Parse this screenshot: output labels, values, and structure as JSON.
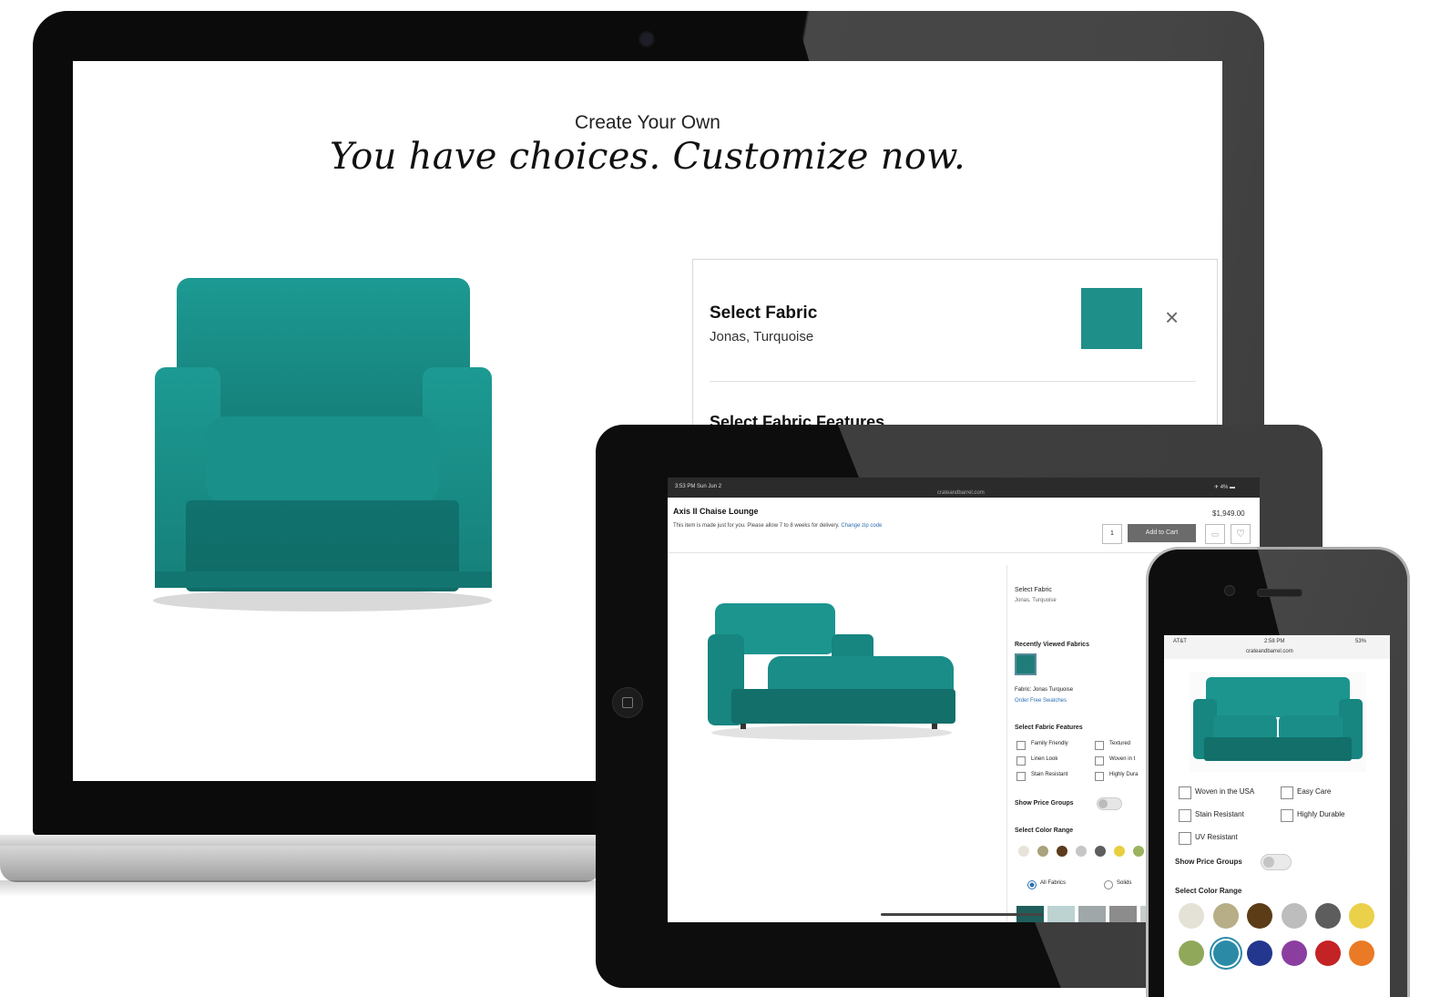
{
  "laptop": {
    "eyebrow": "Create Your Own",
    "headline": "You have choices. Customize now.",
    "panel": {
      "title": "Select Fabric",
      "fabric_name": "Jonas, Turquoise",
      "swatch_color": "#1f8f8a",
      "close_icon": "×",
      "features_heading": "Select Fabric Features"
    }
  },
  "tablet": {
    "status_left": "3:53 PM   Sun Jun 2",
    "status_center": "crateandbarrel.com",
    "status_right": "✈ 4% ▬",
    "product_title": "Axis II Chaise Lounge",
    "note": "This item is made just for you. Please allow 7 to 8 weeks for delivery.",
    "note_link": "Change zip code",
    "price": "$1,949.00",
    "quantity": "1",
    "add_to_cart": "Add to Cart",
    "heart_icon": "♡",
    "side": {
      "select_fabric": "Select Fabric",
      "fabric_value": "Jonas, Turquoise",
      "recently_viewed": "Recently Viewed Fabrics",
      "fabric_line": "Fabric: Jonas Turquoise",
      "order_swatches": "Order Free Swatches",
      "features_heading": "Select Fabric Features",
      "features": [
        "Family Friendly",
        "Textured",
        "Linen Look",
        "Woven in t",
        "Stain Resistant",
        "Highly Dura"
      ],
      "show_price_groups": "Show Price Groups",
      "color_range": "Select Color Range",
      "colors": [
        "#e6e3d8",
        "#a9a27a",
        "#5b3b1a",
        "#c6c6c6",
        "#5e5e5e",
        "#e9cf3e",
        "#9cb35e"
      ],
      "radio_all": "All Fabrics",
      "radio_solids": "Solids"
    },
    "bottom_swatches": [
      "#1f5e5c",
      "#bcd3d2",
      "#9fa7a8",
      "#8c8c8c",
      "#c6cccb"
    ]
  },
  "phone": {
    "status_left": "AT&T",
    "status_time": "2:58 PM",
    "status_right": "53%",
    "url": "crateandbarrel.com",
    "features": [
      "Woven in the USA",
      "Easy Care",
      "Stain Resistant",
      "Highly Durable",
      "UV Resistant"
    ],
    "show_price_groups": "Show Price Groups",
    "color_range": "Select Color Range",
    "colors_row1": [
      "#e4e1d6",
      "#b7ad86",
      "#5b3c17",
      "#bdbdbd",
      "#5d5d5d",
      "#ebd04a"
    ],
    "colors_row2": [
      "#90a85a",
      "#2b8ba6",
      "#23378f",
      "#8b3ea0",
      "#c42325",
      "#ea7a26"
    ]
  }
}
